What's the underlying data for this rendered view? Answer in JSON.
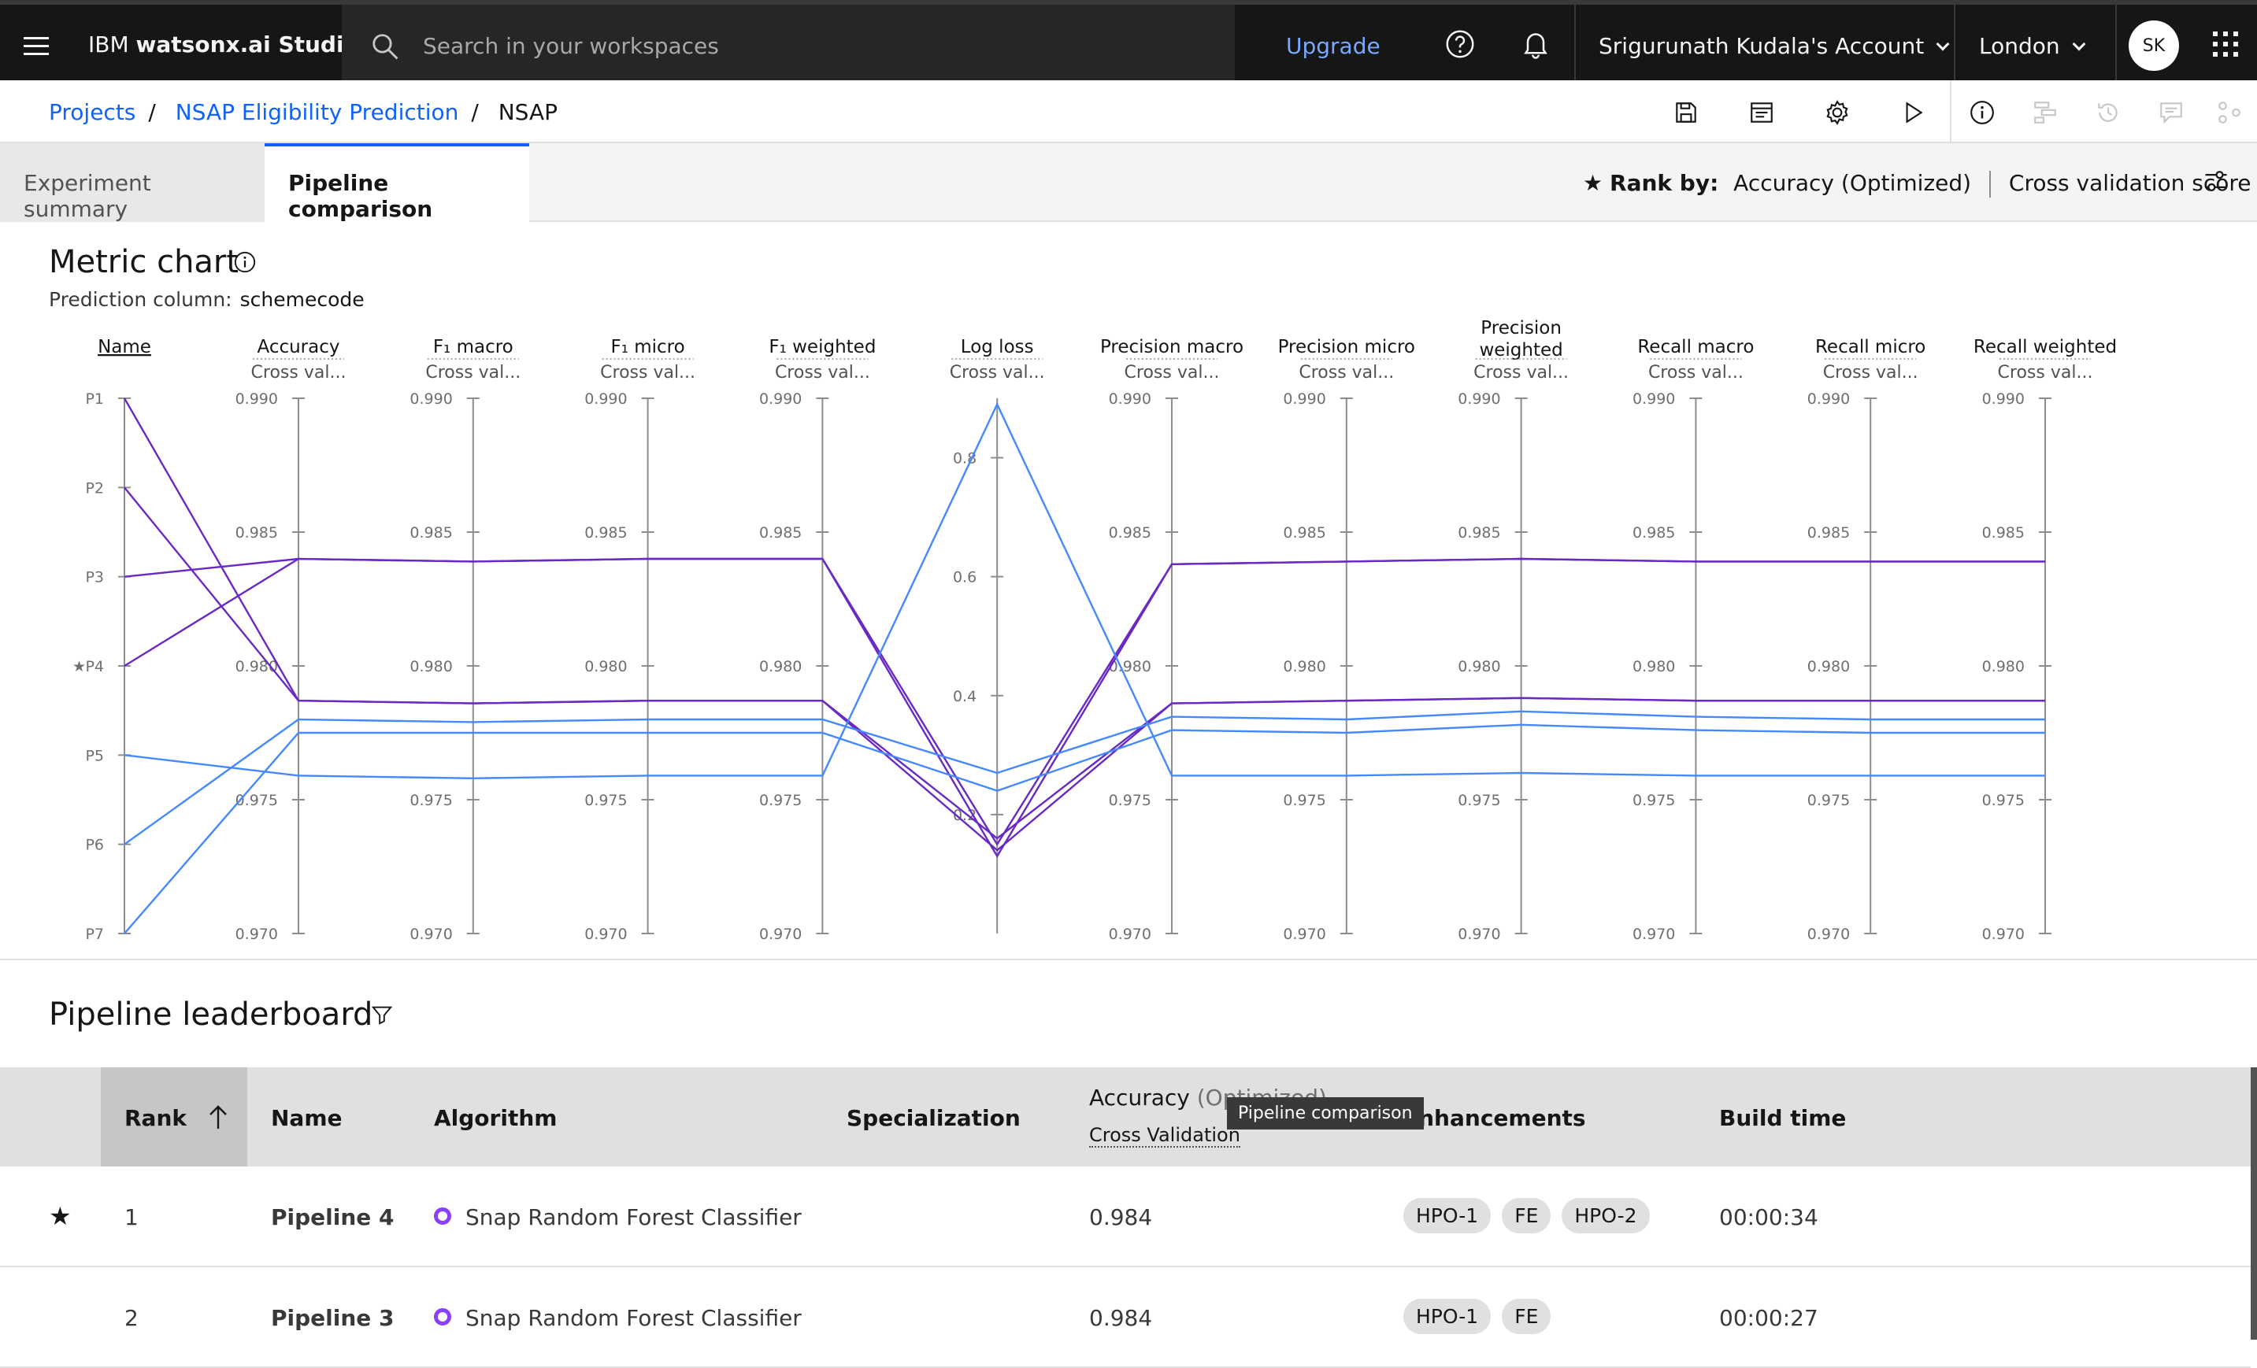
{
  "app": {
    "brand_prefix": "IBM ",
    "brand_name": "watsonx.ai Studio",
    "search_placeholder": "Search in your workspaces",
    "upgrade_label": "Upgrade",
    "account_label": "Srigurunath Kudala's Account",
    "region_label": "London",
    "avatar_initials": "SK"
  },
  "breadcrumb": [
    {
      "label": "Projects"
    },
    {
      "label": "NSAP Eligibility Prediction"
    },
    {
      "label": "NSAP"
    }
  ],
  "tabs": [
    {
      "label": "Experiment summary"
    },
    {
      "label": "Pipeline comparison"
    }
  ],
  "rank_by": {
    "label": "Rank by:",
    "metric": "Accuracy (Optimized)",
    "score": "Cross validation score"
  },
  "metric_chart": {
    "title": "Metric chart",
    "prediction_label": "Prediction column:",
    "prediction_value": "schemecode"
  },
  "chart_data": {
    "type": "parallel-coordinates",
    "name_axis": {
      "label": "Name",
      "ticks": [
        "P1",
        "P2",
        "P3",
        "P4",
        "P5",
        "P6",
        "P7"
      ],
      "starred": "P4"
    },
    "axes": [
      {
        "label": "Accuracy",
        "sub": "Cross val...",
        "ticks": [
          "0.990",
          "0.985",
          "0.980",
          "0.975",
          "0.970"
        ],
        "range": [
          0.97,
          0.99
        ]
      },
      {
        "label": "F₁ macro",
        "sub": "Cross val...",
        "ticks": [
          "0.990",
          "0.985",
          "0.980",
          "0.975",
          "0.970"
        ],
        "range": [
          0.97,
          0.99
        ]
      },
      {
        "label": "F₁ micro",
        "sub": "Cross val...",
        "ticks": [
          "0.990",
          "0.985",
          "0.980",
          "0.975",
          "0.970"
        ],
        "range": [
          0.97,
          0.99
        ]
      },
      {
        "label": "F₁ weighted",
        "sub": "Cross val...",
        "ticks": [
          "0.990",
          "0.985",
          "0.980",
          "0.975",
          "0.970"
        ],
        "range": [
          0.97,
          0.99
        ]
      },
      {
        "label": "Log loss",
        "sub": "Cross val...",
        "ticks": [
          "0.8",
          "0.6",
          "0.4",
          "0.2"
        ],
        "range": [
          0.0,
          0.9
        ],
        "loglossTicks": [
          0.8,
          0.6,
          0.4,
          0.2
        ]
      },
      {
        "label": "Precision macro",
        "sub": "Cross val...",
        "ticks": [
          "0.990",
          "0.985",
          "0.980",
          "0.975",
          "0.970"
        ],
        "range": [
          0.97,
          0.99
        ]
      },
      {
        "label": "Precision micro",
        "sub": "Cross val...",
        "ticks": [
          "0.990",
          "0.985",
          "0.980",
          "0.975",
          "0.970"
        ],
        "range": [
          0.97,
          0.99
        ]
      },
      {
        "label": "Precision weighted",
        "sub": "Cross val...",
        "ticks": [
          "0.990",
          "0.985",
          "0.980",
          "0.975",
          "0.970"
        ],
        "range": [
          0.97,
          0.99
        ]
      },
      {
        "label": "Recall macro",
        "sub": "Cross val...",
        "ticks": [
          "0.990",
          "0.985",
          "0.980",
          "0.975",
          "0.970"
        ],
        "range": [
          0.97,
          0.99
        ]
      },
      {
        "label": "Recall micro",
        "sub": "Cross val...",
        "ticks": [
          "0.990",
          "0.985",
          "0.980",
          "0.975",
          "0.970"
        ],
        "range": [
          0.97,
          0.99
        ]
      },
      {
        "label": "Recall weighted",
        "sub": "Cross val...",
        "ticks": [
          "0.990",
          "0.985",
          "0.980",
          "0.975",
          "0.970"
        ],
        "range": [
          0.97,
          0.99
        ]
      }
    ],
    "series": [
      {
        "pipeline": "P1",
        "color": "#6929c4",
        "values": [
          0.9787,
          0.9786,
          0.9787,
          0.9787,
          0.14,
          0.9786,
          0.9787,
          0.9788,
          0.9787,
          0.9787,
          0.9787
        ]
      },
      {
        "pipeline": "P2",
        "color": "#6929c4",
        "values": [
          0.9787,
          0.9786,
          0.9787,
          0.9787,
          0.16,
          0.9786,
          0.9787,
          0.9788,
          0.9787,
          0.9787,
          0.9787
        ]
      },
      {
        "pipeline": "P3",
        "color": "#6929c4",
        "values": [
          0.984,
          0.9839,
          0.984,
          0.984,
          0.13,
          0.9838,
          0.9839,
          0.984,
          0.9839,
          0.9839,
          0.9839
        ]
      },
      {
        "pipeline": "P4",
        "color": "#6929c4",
        "values": [
          0.984,
          0.9839,
          0.984,
          0.984,
          0.15,
          0.9838,
          0.9839,
          0.984,
          0.9839,
          0.9839,
          0.9839
        ]
      },
      {
        "pipeline": "P5",
        "color": "#4589ff",
        "values": [
          0.9759,
          0.9758,
          0.9759,
          0.9759,
          0.89,
          0.9759,
          0.9759,
          0.976,
          0.9759,
          0.9759,
          0.9759
        ]
      },
      {
        "pipeline": "P6",
        "color": "#4589ff",
        "values": [
          0.978,
          0.9779,
          0.978,
          0.978,
          0.27,
          0.9781,
          0.978,
          0.9783,
          0.9781,
          0.978,
          0.978
        ]
      },
      {
        "pipeline": "P7",
        "color": "#4589ff",
        "values": [
          0.9775,
          0.9775,
          0.9775,
          0.9775,
          0.24,
          0.9776,
          0.9775,
          0.9778,
          0.9776,
          0.9775,
          0.9775
        ]
      }
    ]
  },
  "leaderboard": {
    "title": "Pipeline leaderboard",
    "columns": {
      "rank": "Rank",
      "name": "Name",
      "algorithm": "Algorithm",
      "specialization": "Specialization",
      "accuracy": "Accuracy",
      "accuracy_optimized": "(Optimized)",
      "accuracy_sub": "Cross Validation",
      "enhancements": "Enhancements",
      "build_time": "Build time"
    },
    "rows": [
      {
        "rank": "1",
        "name": "Pipeline 4",
        "algorithm": "Snap Random Forest Classifier",
        "accuracy": "0.984",
        "tags": [
          "HPO-1",
          "FE",
          "HPO-2"
        ],
        "build_time": "00:00:34",
        "starred": true
      },
      {
        "rank": "2",
        "name": "Pipeline 3",
        "algorithm": "Snap Random Forest Classifier",
        "accuracy": "0.984",
        "tags": [
          "HPO-1",
          "FE"
        ],
        "build_time": "00:00:27",
        "starred": false
      }
    ]
  },
  "tooltip": "Pipeline comparison"
}
